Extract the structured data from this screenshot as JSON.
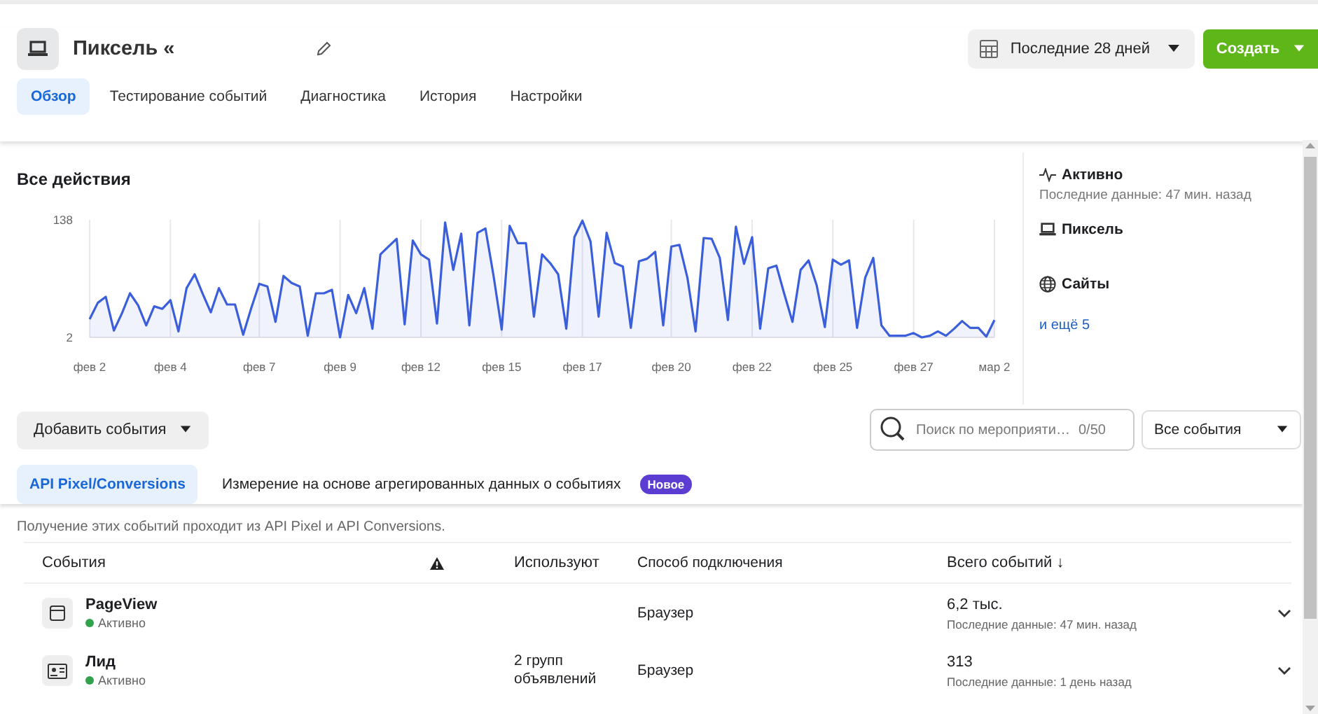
{
  "header": {
    "title": "Пиксель «",
    "date_range": "Последние 28 дней",
    "create_button": "Создать"
  },
  "tabs": [
    {
      "label": "Обзор",
      "selected": true
    },
    {
      "label": "Тестирование событий",
      "selected": false
    },
    {
      "label": "Диагностика",
      "selected": false
    },
    {
      "label": "История",
      "selected": false
    },
    {
      "label": "Настройки",
      "selected": false
    }
  ],
  "overview": {
    "title": "Все действия",
    "chart_data": {
      "type": "area",
      "categories": [
        "фев 2",
        null,
        null,
        null,
        null,
        null,
        null,
        null,
        null,
        null,
        "фев 4",
        null,
        null,
        null,
        null,
        null,
        null,
        null,
        null,
        null,
        null,
        "фев 7",
        null,
        null,
        null,
        null,
        null,
        null,
        null,
        null,
        null,
        "фев 9",
        null,
        null,
        null,
        null,
        null,
        null,
        null,
        null,
        null,
        "фев 12",
        null,
        null,
        null,
        null,
        null,
        null,
        null,
        null,
        null,
        "фев 15",
        null,
        null,
        null,
        null,
        null,
        null,
        null,
        null,
        null,
        "фев 17",
        null,
        null,
        null,
        null,
        null,
        null,
        null,
        null,
        null,
        null,
        "фев 20",
        null,
        null,
        null,
        null,
        null,
        null,
        null,
        null,
        null,
        "фев 22",
        null,
        null,
        null,
        null,
        null,
        null,
        null,
        null,
        null,
        "фев 25",
        null,
        null,
        null,
        null,
        null,
        null,
        null,
        null,
        null,
        "фев 27",
        null,
        null,
        null,
        null,
        null,
        null,
        null,
        null,
        null,
        "мар 2"
      ],
      "series": [
        {
          "color": "#3b5fdb",
          "values": [
            23,
            42,
            49,
            10,
            30,
            53,
            39,
            16,
            38,
            35,
            45,
            9,
            59,
            75,
            52,
            31,
            59,
            40,
            40,
            5,
            36,
            64,
            61,
            20,
            73,
            65,
            61,
            4,
            53,
            53,
            57,
            2,
            51,
            30,
            59,
            12,
            98,
            107,
            116,
            17,
            114,
            98,
            92,
            18,
            135,
            80,
            122,
            16,
            123,
            128,
            73,
            11,
            131,
            111,
            111,
            26,
            98,
            88,
            75,
            12,
            118,
            137,
            113,
            26,
            123,
            88,
            84,
            13,
            90,
            93,
            101,
            16,
            107,
            109,
            71,
            9,
            117,
            116,
            94,
            22,
            130,
            87,
            118,
            12,
            82,
            85,
            52,
            20,
            80,
            91,
            62,
            14,
            92,
            86,
            91,
            13,
            71,
            94,
            16,
            4,
            4,
            4,
            7,
            2,
            4,
            9,
            4,
            12,
            21,
            13,
            13,
            3,
            22
          ]
        }
      ],
      "ylim": [
        2,
        138
      ],
      "yticks": [
        2,
        138
      ],
      "grid": true
    }
  },
  "summary": {
    "status": "Активно",
    "last_data": "Последние данные: 47 мин. назад",
    "pixel_label": "Пиксель",
    "sites_label": "Сайты",
    "more_link": "и ещё 5"
  },
  "toolbar": {
    "add_events": "Добавить события",
    "search": {
      "placeholder": "Поиск по мероприяти…",
      "counter": "0/50"
    },
    "filter": "Все события"
  },
  "source_tabs": [
    {
      "label": "API Pixel/Conversions",
      "selected": true
    },
    {
      "label": "Измерение на основе агрегированных данных о событиях",
      "selected": false,
      "badge": "Новое"
    }
  ],
  "note": "Получение этих событий проходит из API Pixel и API Conversions.",
  "table": {
    "columns": [
      {
        "kind": "text",
        "label": "События"
      },
      {
        "kind": "warning"
      },
      {
        "kind": "text",
        "label": "Используют"
      },
      {
        "kind": "text",
        "label": "Способ подключения"
      },
      {
        "kind": "text",
        "label": "Всего событий ↓"
      }
    ],
    "rows": [
      {
        "kind": "page",
        "name": "PageView",
        "status": "Активно",
        "color": "#31a24c",
        "method": "Браузер",
        "total": "6,2 тыс.",
        "last_data": "Последние данные: 47 мин. назад"
      },
      {
        "kind": "lead",
        "name": "Лид",
        "status": "Активно",
        "color": "#31a24c",
        "used_by": "2 групп объявлений",
        "method": "Браузер",
        "total": "313",
        "last_data": "Последние данные: 1 день назад"
      }
    ]
  }
}
